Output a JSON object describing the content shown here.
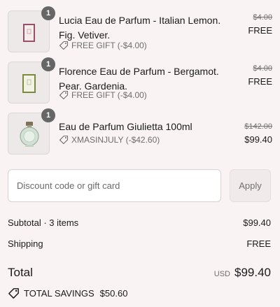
{
  "items": [
    {
      "quantity": "1",
      "name": "Lucia Eau de Parfum - Italian Lemon. Fig. Vetiver.",
      "discount": "FREE GIFT (-$4.00)",
      "original_price": "$4.00",
      "final_price": "FREE",
      "thumb_color": "#9b4d6a"
    },
    {
      "quantity": "1",
      "name": "Florence Eau de Parfum - Bergamot. Pear. Gardenia.",
      "discount": "FREE GIFT (-$4.00)",
      "original_price": "$4.00",
      "final_price": "FREE",
      "thumb_color": "#7a8c3a"
    },
    {
      "quantity": "1",
      "name": "Eau de Parfum Giulietta 100ml",
      "discount": "XMASINJULY (-$42.60)",
      "original_price": "$142.00",
      "final_price": "$99.40",
      "thumb_color": "#9bb29f"
    }
  ],
  "discount_code": {
    "placeholder": "Discount code or gift card",
    "value": "",
    "apply_label": "Apply"
  },
  "summary": {
    "subtotal_label": "Subtotal · 3 items",
    "subtotal_value": "$99.40",
    "shipping_label": "Shipping",
    "shipping_value": "FREE",
    "total_label": "Total",
    "currency": "USD",
    "total_value": "$99.40",
    "savings_label": "TOTAL SAVINGS",
    "savings_value": "$50.60"
  },
  "colors": {
    "background": "#f9f4f3",
    "badge": "#666666",
    "muted_text": "#6e6e6e"
  }
}
